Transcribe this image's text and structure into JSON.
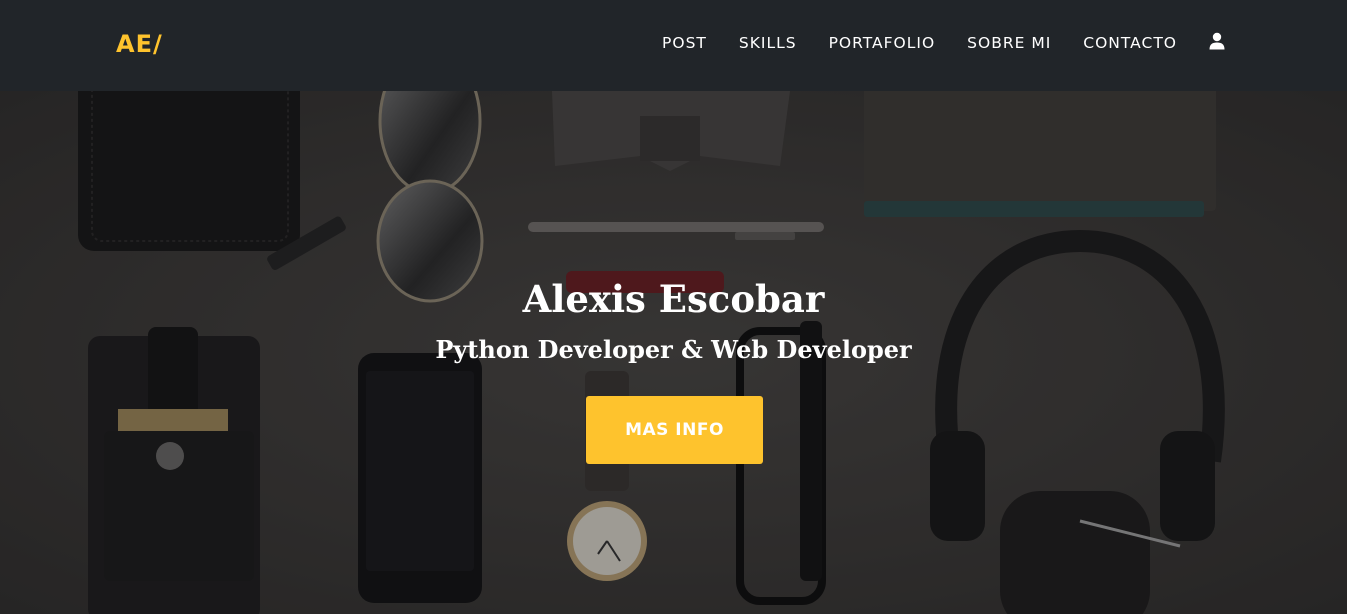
{
  "navbar": {
    "brand": "AE/",
    "links": [
      "POST",
      "SKILLS",
      "PORTAFOLIO",
      "SOBRE MI",
      "CONTACTO"
    ],
    "user_icon": "user-icon"
  },
  "hero": {
    "title": "Alexis Escobar",
    "subtitle": "Python Developer & Web Developer",
    "button_label": "MAS INFO"
  },
  "colors": {
    "navbar_bg": "#212529",
    "accent": "#fec32d",
    "text": "#ffffff"
  }
}
